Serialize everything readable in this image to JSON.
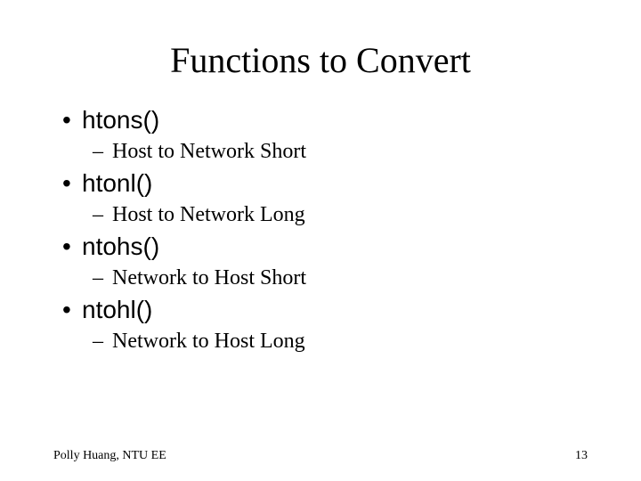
{
  "title": "Functions to Convert",
  "items": [
    {
      "main": "htons()",
      "sub": "Host to Network Short"
    },
    {
      "main": "htonl()",
      "sub": "Host to Network Long"
    },
    {
      "main": "ntohs()",
      "sub": "Network to Host Short"
    },
    {
      "main": "ntohl()",
      "sub": "Network to Host Long"
    }
  ],
  "footer": {
    "author": "Polly Huang, NTU EE",
    "page": "13"
  }
}
